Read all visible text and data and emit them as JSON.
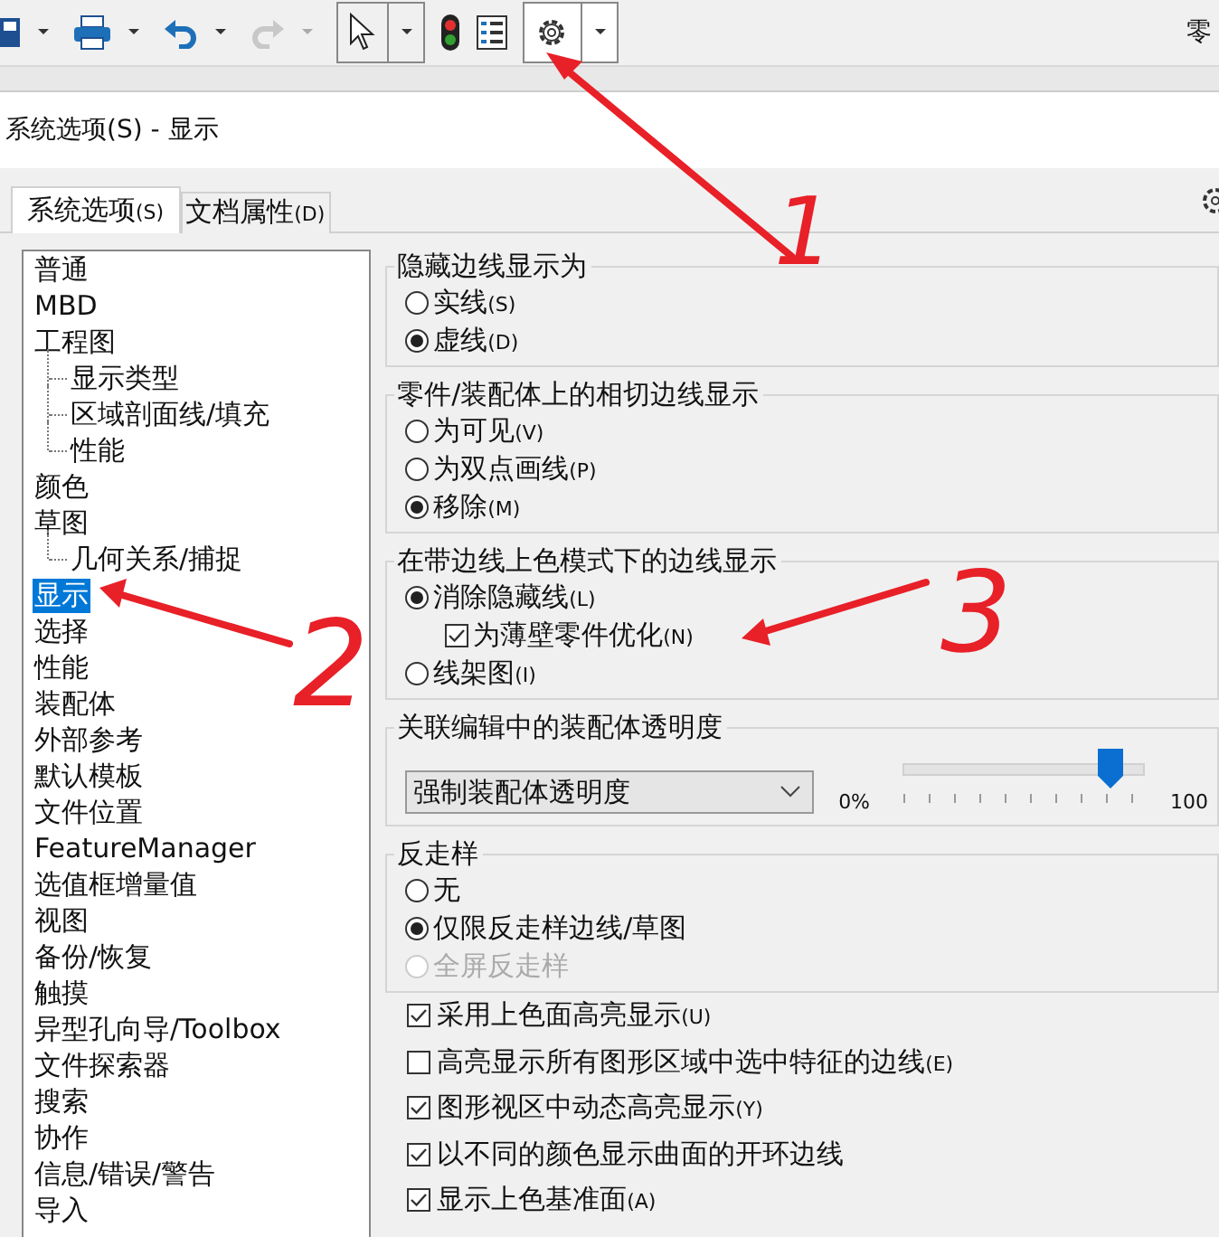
{
  "toolbar": {
    "doc_title": "零"
  },
  "window": {
    "title": "系统选项(S) - 显示"
  },
  "tabs": [
    {
      "label": "系统选项",
      "key": "(S)",
      "selected": true
    },
    {
      "label": "文档属性",
      "key": "(D)",
      "selected": false
    }
  ],
  "tree": [
    {
      "label": "普通",
      "selected": false
    },
    {
      "label": "MBD",
      "selected": false
    },
    {
      "label": "工程图",
      "selected": false,
      "children": [
        {
          "label": "显示类型",
          "selected": false
        },
        {
          "label": "区域剖面线/填充",
          "selected": false
        },
        {
          "label": "性能",
          "selected": false
        }
      ]
    },
    {
      "label": "颜色",
      "selected": false
    },
    {
      "label": "草图",
      "selected": false,
      "children": [
        {
          "label": "几何关系/捕捉",
          "selected": false
        }
      ]
    },
    {
      "label": "显示",
      "selected": true
    },
    {
      "label": "选择",
      "selected": false
    },
    {
      "label": "性能",
      "selected": false
    },
    {
      "label": "装配体",
      "selected": false
    },
    {
      "label": "外部参考",
      "selected": false
    },
    {
      "label": "默认模板",
      "selected": false
    },
    {
      "label": "文件位置",
      "selected": false
    },
    {
      "label": "FeatureManager",
      "selected": false
    },
    {
      "label": "选值框增量值",
      "selected": false
    },
    {
      "label": "视图",
      "selected": false
    },
    {
      "label": "备份/恢复",
      "selected": false
    },
    {
      "label": "触摸",
      "selected": false
    },
    {
      "label": "异型孔向导/Toolbox",
      "selected": false
    },
    {
      "label": "文件探索器",
      "selected": false
    },
    {
      "label": "搜索",
      "selected": false
    },
    {
      "label": "协作",
      "selected": false
    },
    {
      "label": "信息/错误/警告",
      "selected": false
    },
    {
      "label": "导入",
      "selected": false
    }
  ],
  "groups": [
    {
      "kind": "options",
      "title": "隐藏边线显示为",
      "items": [
        {
          "kind": "radio",
          "label": "实线",
          "key": "(S)",
          "selected": false,
          "disabled": false
        },
        {
          "kind": "radio",
          "label": "虚线",
          "key": "(D)",
          "selected": true,
          "disabled": false
        }
      ]
    },
    {
      "kind": "options",
      "title": "零件/装配体上的相切边线显示",
      "items": [
        {
          "kind": "radio",
          "label": "为可见",
          "key": "(V)",
          "selected": false,
          "disabled": false
        },
        {
          "kind": "radio",
          "label": "为双点画线",
          "key": "(P)",
          "selected": false,
          "disabled": false
        },
        {
          "kind": "radio",
          "label": "移除",
          "key": "(M)",
          "selected": true,
          "disabled": false
        }
      ]
    },
    {
      "kind": "options",
      "title": "在带边线上色模式下的边线显示",
      "items": [
        {
          "kind": "radio",
          "label": "消除隐藏线",
          "key": "(L)",
          "selected": true,
          "disabled": false
        },
        {
          "kind": "checkbox",
          "label": "为薄壁零件优化",
          "key": "(N)",
          "checked": true
        },
        {
          "kind": "radio",
          "label": "线架图",
          "key": "(I)",
          "selected": false,
          "disabled": false
        }
      ]
    },
    {
      "kind": "transparency",
      "title": "关联编辑中的装配体透明度",
      "dropdown": {
        "value": "强制装配体透明度"
      },
      "slider": {
        "min_label": "0%",
        "max_label": "100",
        "level": 0.86
      }
    },
    {
      "kind": "options",
      "title": "反走样",
      "items": [
        {
          "kind": "radio",
          "label": "无",
          "selected": false,
          "disabled": false
        },
        {
          "kind": "radio",
          "label": "仅限反走样边线/草图",
          "selected": true,
          "disabled": false
        },
        {
          "kind": "radio",
          "label": "全屏反走样",
          "selected": false,
          "disabled": true
        }
      ]
    }
  ],
  "checkboxes": [
    {
      "label": "采用上色面高亮显示",
      "key": "(U)",
      "checked": true
    },
    {
      "label": "高亮显示所有图形区域中选中特征的边线",
      "key": "(E)",
      "checked": false
    },
    {
      "label": "图形视区中动态高亮显示",
      "key": "(Y)",
      "checked": true
    },
    {
      "label": "以不同的颜色显示曲面的开环边线",
      "checked": true
    },
    {
      "label": "显示上色基准面",
      "key": "(A)",
      "checked": true
    }
  ],
  "annotations": [
    {
      "label": "1"
    },
    {
      "label": "2"
    },
    {
      "label": "3"
    }
  ]
}
